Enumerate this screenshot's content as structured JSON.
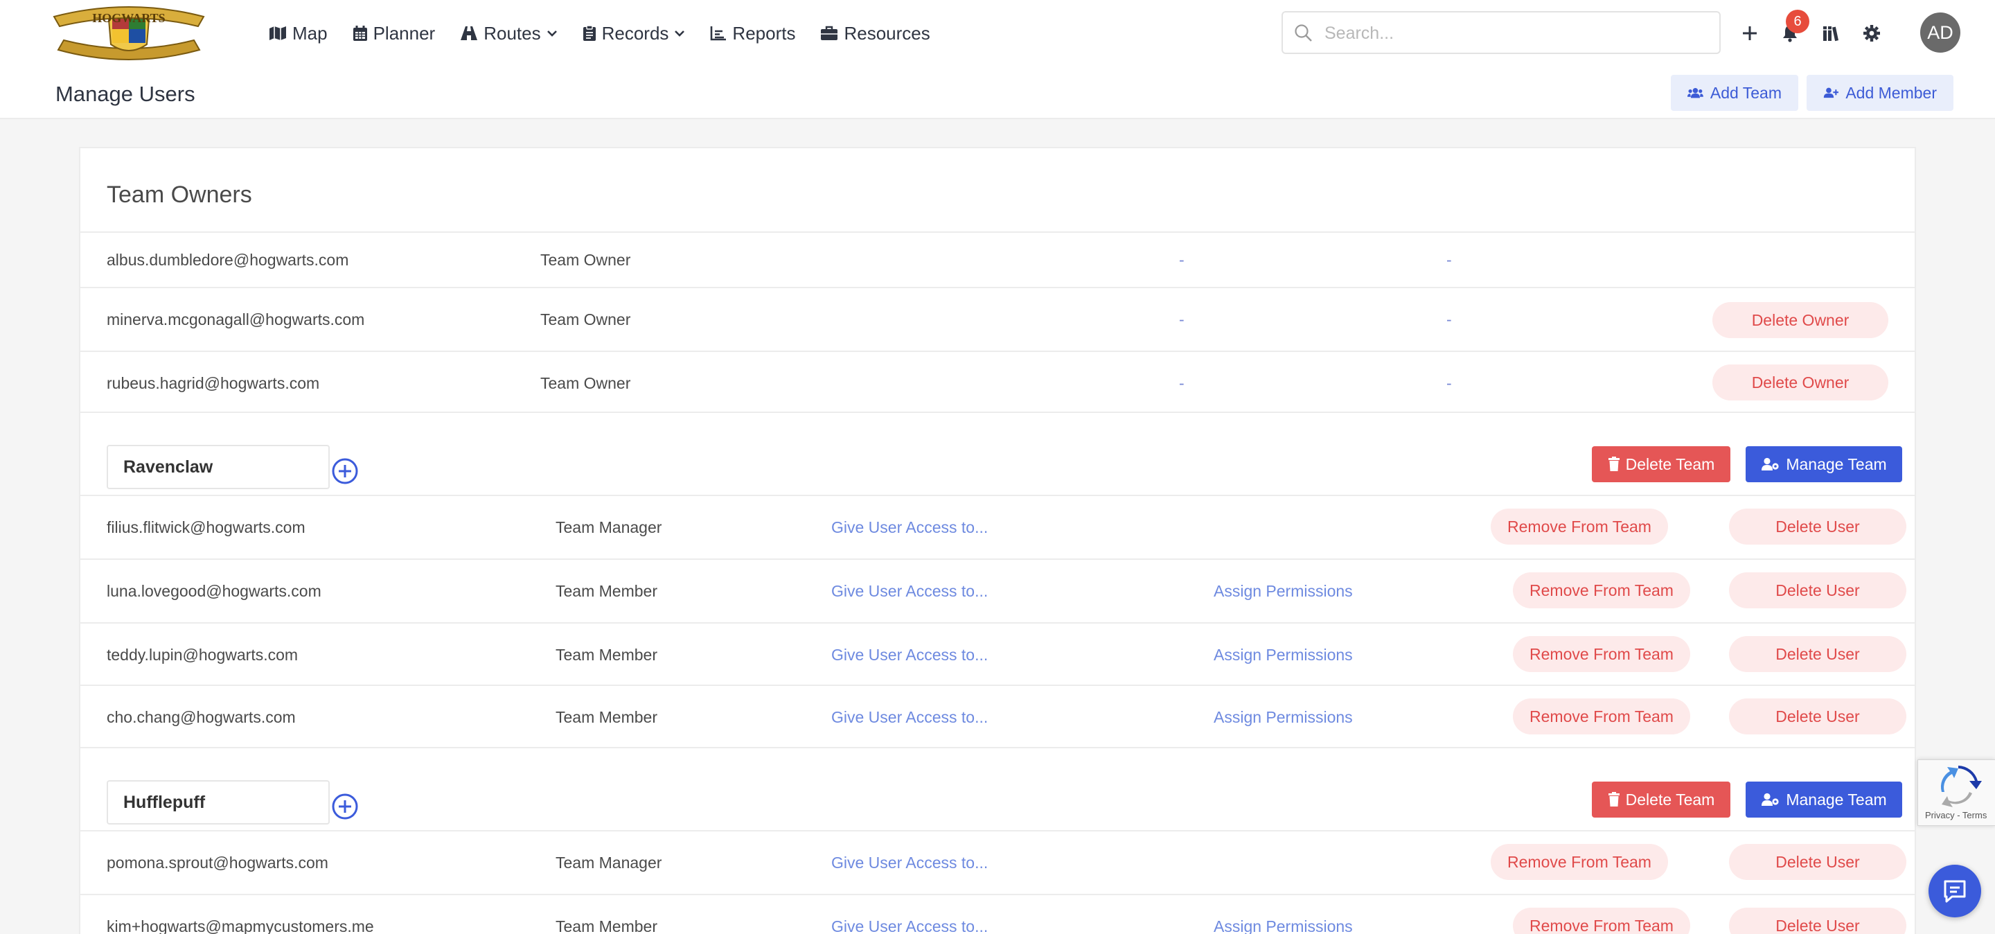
{
  "nav": {
    "logo_alt": "HOGWARTS",
    "items": [
      {
        "label": "Map",
        "icon": "map-icon"
      },
      {
        "label": "Planner",
        "icon": "calendar-icon"
      },
      {
        "label": "Routes",
        "icon": "route-icon",
        "dropdown": true
      },
      {
        "label": "Records",
        "icon": "clipboard-icon",
        "dropdown": true
      },
      {
        "label": "Reports",
        "icon": "bar-chart-icon"
      },
      {
        "label": "Resources",
        "icon": "briefcase-icon"
      }
    ],
    "search_placeholder": "Search...",
    "notification_count": "6",
    "avatar_initials": "AD"
  },
  "header": {
    "title": "Manage Users",
    "add_team_label": "Add Team",
    "add_member_label": "Add Member"
  },
  "owners": {
    "title": "Team Owners",
    "rows": [
      {
        "email": "albus.dumbledore@hogwarts.com",
        "role": "Team Owner",
        "col3": "-",
        "col4": "-",
        "action": ""
      },
      {
        "email": "minerva.mcgonagall@hogwarts.com",
        "role": "Team Owner",
        "col3": "-",
        "col4": "-",
        "action": "Delete Owner"
      },
      {
        "email": "rubeus.hagrid@hogwarts.com",
        "role": "Team Owner",
        "col3": "-",
        "col4": "-",
        "action": "Delete Owner"
      }
    ]
  },
  "team_actions": {
    "delete_team": "Delete Team",
    "manage_team": "Manage Team",
    "give_access": "Give User Access to...",
    "assign_permissions": "Assign Permissions",
    "remove_from_team": "Remove From Team",
    "delete_user": "Delete User"
  },
  "teams": [
    {
      "name": "Ravenclaw",
      "members": [
        {
          "email": "filius.flitwick@hogwarts.com",
          "role": "Team Manager"
        },
        {
          "email": "luna.lovegood@hogwarts.com",
          "role": "Team Member"
        },
        {
          "email": "teddy.lupin@hogwarts.com",
          "role": "Team Member"
        },
        {
          "email": "cho.chang@hogwarts.com",
          "role": "Team Member"
        }
      ]
    },
    {
      "name": "Hufflepuff",
      "members": [
        {
          "email": "pomona.sprout@hogwarts.com",
          "role": "Team Manager"
        },
        {
          "email": "kim+hogwarts@mapmycustomers.me",
          "role": "Team Member"
        }
      ]
    }
  ],
  "recaptcha": {
    "text": "Privacy - Terms"
  },
  "colors": {
    "primary": "#3b5bdb",
    "danger": "#e55656",
    "danger_soft": "#fdeaea",
    "link": "#6e8ae0"
  }
}
